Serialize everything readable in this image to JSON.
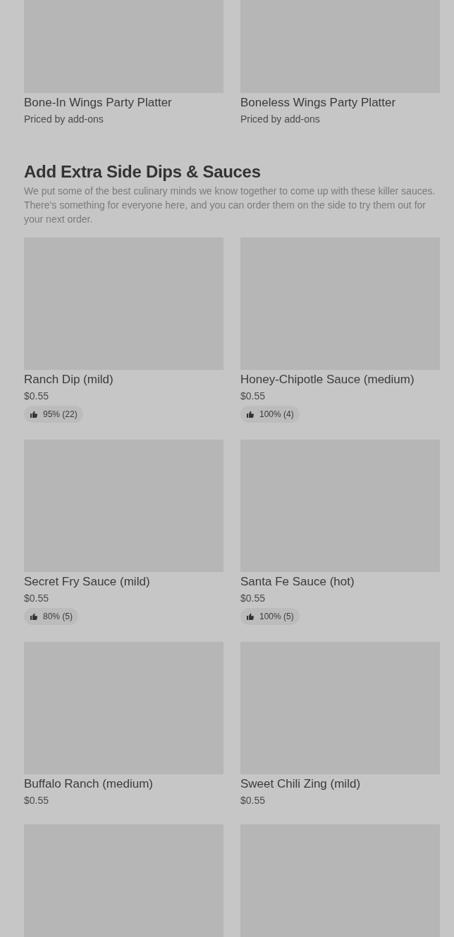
{
  "top_items": [
    {
      "name": "Bone-In Wings Party Platter",
      "price": "Priced by add-ons"
    },
    {
      "name": "Boneless Wings Party Platter",
      "price": "Priced by add-ons"
    }
  ],
  "section": {
    "title": "Add Extra Side Dips & Sauces",
    "description": "We put some of the best culinary minds we know together to come up with these killer sauces. There's something for everyone here, and you can order them on the side to try them out for your next order.",
    "items": [
      {
        "name": "Ranch Dip (mild)",
        "price": "$0.55",
        "rating": "95% (22)"
      },
      {
        "name": "Honey-Chipotle Sauce (medium)",
        "price": "$0.55",
        "rating": "100% (4)"
      },
      {
        "name": "Secret Fry Sauce (mild)",
        "price": "$0.55",
        "rating": "80% (5)"
      },
      {
        "name": "Santa Fe Sauce (hot)",
        "price": "$0.55",
        "rating": "100% (5)"
      },
      {
        "name": "Buffalo Ranch (medium)",
        "price": "$0.55"
      },
      {
        "name": "Sweet Chili Zing (mild)",
        "price": "$0.55"
      }
    ]
  }
}
